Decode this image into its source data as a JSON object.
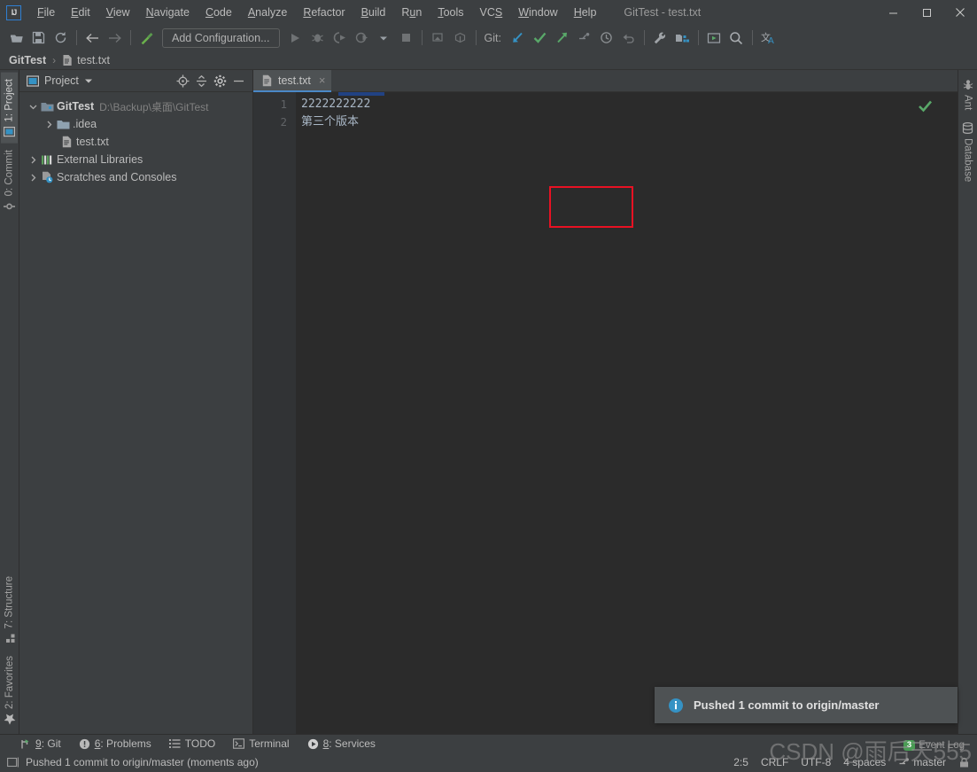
{
  "window": {
    "title": "GitTest - test.txt",
    "logo_text": "IJ",
    "controls": [
      "minimize",
      "maximize",
      "close"
    ]
  },
  "menu": [
    {
      "label": "File",
      "accel": "F"
    },
    {
      "label": "Edit",
      "accel": "E"
    },
    {
      "label": "View",
      "accel": "V"
    },
    {
      "label": "Navigate",
      "accel": "N"
    },
    {
      "label": "Code",
      "accel": "C"
    },
    {
      "label": "Analyze",
      "accel": "A"
    },
    {
      "label": "Refactor",
      "accel": "R"
    },
    {
      "label": "Build",
      "accel": "B"
    },
    {
      "label": "Run",
      "accel": "u"
    },
    {
      "label": "Tools",
      "accel": "T"
    },
    {
      "label": "VCS",
      "accel": "S"
    },
    {
      "label": "Window",
      "accel": "W"
    },
    {
      "label": "Help",
      "accel": "H"
    }
  ],
  "toolbar": {
    "run_config_label": "Add Configuration...",
    "git_label": "Git:",
    "icons": [
      "open-folder-icon",
      "save-all-icon",
      "sync-icon",
      "back-arrow-icon",
      "forward-arrow-icon",
      "build-hammer-icon",
      "run-icon",
      "debug-icon",
      "run-with-coverage-icon",
      "profile-icon",
      "stop-icon",
      "toggle-bookmark-icon",
      "deploy-icon",
      "git-update-icon",
      "git-commit-icon",
      "git-push-icon",
      "git-branch-icon",
      "git-history-icon",
      "git-revert-icon",
      "settings-wrench-icon",
      "project-structure-icon",
      "run-anything-icon",
      "search-everywhere-icon",
      "translate-icon"
    ]
  },
  "breadcrumb": {
    "project": "GitTest",
    "separator": "›",
    "file": "test.txt"
  },
  "strip_left": {
    "top": [
      {
        "label": "1: Project",
        "accel": "1",
        "active": true,
        "icon": "project-icon"
      },
      {
        "label": "0: Commit",
        "accel": "0",
        "active": false,
        "icon": "commit-icon"
      }
    ],
    "bottom": [
      {
        "label": "7: Structure",
        "accel": "7",
        "active": false,
        "icon": "structure-icon"
      },
      {
        "label": "2: Favorites",
        "accel": "2",
        "active": false,
        "icon": "star-icon"
      }
    ]
  },
  "strip_right": {
    "items": [
      {
        "label": "Ant",
        "icon": "ant-icon"
      },
      {
        "label": "Database",
        "icon": "database-icon"
      }
    ]
  },
  "project_panel": {
    "title": "Project",
    "header_icons": [
      "locate-icon",
      "collapse-all-icon",
      "settings-gear-icon",
      "hide-icon"
    ],
    "tree": [
      {
        "level": 1,
        "label": "GitTest",
        "path": "D:\\Backup\\桌面\\GitTest",
        "icon": "module-icon",
        "expanded": true,
        "bold": true
      },
      {
        "level": 2,
        "label": ".idea",
        "path": "",
        "icon": "folder-icon",
        "expanded": false,
        "bold": false
      },
      {
        "level": 3,
        "label": "test.txt",
        "path": "",
        "icon": "text-file-icon",
        "expanded": null,
        "bold": false
      },
      {
        "level": 1,
        "label": "External Libraries",
        "path": "",
        "icon": "libraries-icon",
        "expanded": false,
        "bold": false
      },
      {
        "level": 1,
        "label": "Scratches and Consoles",
        "path": "",
        "icon": "scratches-icon",
        "expanded": false,
        "bold": false
      }
    ]
  },
  "editor": {
    "tab": {
      "label": "test.txt",
      "icon": "text-file-icon",
      "close": "×"
    },
    "line_numbers": [
      "1",
      "2"
    ],
    "lines": [
      "2222222222",
      "第三个版本"
    ],
    "inspection_status": "ok-checkmark",
    "annotation_box_color": "#e81123"
  },
  "notification": {
    "icon": "info-icon",
    "message": "Pushed 1 commit to origin/master"
  },
  "toolwindow_bar": [
    {
      "label": "9: Git",
      "accel": "9",
      "icon": "git-icon"
    },
    {
      "label": "6: Problems",
      "accel": "6",
      "icon": "problems-icon"
    },
    {
      "label": "TODO",
      "accel": "",
      "icon": "todo-icon"
    },
    {
      "label": "Terminal",
      "accel": "",
      "icon": "terminal-icon"
    },
    {
      "label": "8: Services",
      "accel": "8",
      "icon": "services-icon"
    }
  ],
  "statusbar": {
    "message": "Pushed 1 commit to origin/master (moments ago)",
    "message_icon": "window-icon",
    "caret_position": "2:5",
    "line_separator": "CRLF",
    "encoding": "UTF-8",
    "indent": "4 spaces",
    "branch": "master",
    "branch_icon": "git-branch-icon",
    "lock_icon": "read-only-icon"
  },
  "event_log": {
    "label": "Event Log",
    "count": "3"
  },
  "watermark": {
    "text": "CSDN @雨后天555"
  }
}
